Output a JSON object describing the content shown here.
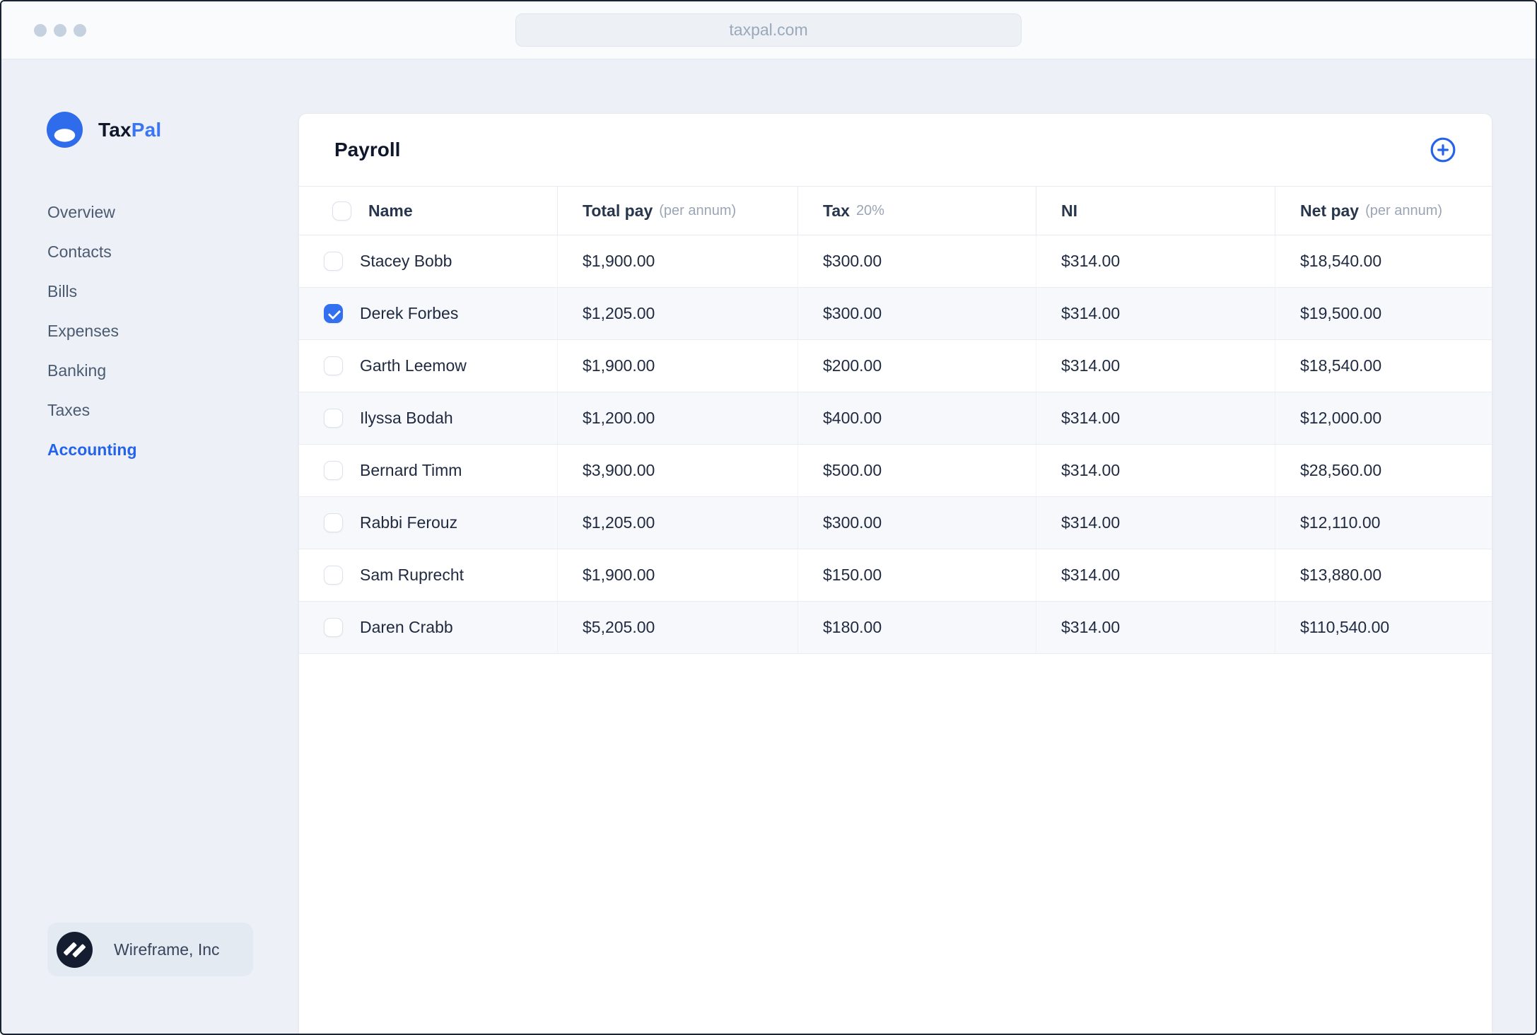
{
  "browser": {
    "url": "taxpal.com"
  },
  "brand": {
    "name_primary": "Tax",
    "name_secondary": "Pal"
  },
  "sidebar": {
    "items": [
      "Overview",
      "Contacts",
      "Bills",
      "Expenses",
      "Banking",
      "Taxes",
      "Accounting"
    ],
    "active_item": "Accounting",
    "org": {
      "name": "Wireframe, Inc"
    }
  },
  "main": {
    "title": "Payroll"
  },
  "table": {
    "select_all_checked": false,
    "columns": [
      {
        "label": "Name",
        "sub": ""
      },
      {
        "label": "Total pay",
        "sub": "(per annum)"
      },
      {
        "label": "Tax",
        "sub": "20%"
      },
      {
        "label": "NI",
        "sub": ""
      },
      {
        "label": "Net pay",
        "sub": "(per annum)"
      }
    ],
    "rows": [
      {
        "name": "Stacey Bobb",
        "total_pay": "$1,900.00",
        "tax": "$300.00",
        "ni": "$314.00",
        "net_pay": "$18,540.00",
        "checked": false
      },
      {
        "name": "Derek Forbes",
        "total_pay": "$1,205.00",
        "tax": "$300.00",
        "ni": "$314.00",
        "net_pay": "$19,500.00",
        "checked": true
      },
      {
        "name": "Garth Leemow",
        "total_pay": "$1,900.00",
        "tax": "$200.00",
        "ni": "$314.00",
        "net_pay": "$18,540.00",
        "checked": false
      },
      {
        "name": "Ilyssa Bodah",
        "total_pay": "$1,200.00",
        "tax": "$400.00",
        "ni": "$314.00",
        "net_pay": "$12,000.00",
        "checked": false
      },
      {
        "name": "Bernard Timm",
        "total_pay": "$3,900.00",
        "tax": "$500.00",
        "ni": "$314.00",
        "net_pay": "$28,560.00",
        "checked": false
      },
      {
        "name": "Rabbi Ferouz",
        "total_pay": "$1,205.00",
        "tax": "$300.00",
        "ni": "$314.00",
        "net_pay": "$12,110.00",
        "checked": false
      },
      {
        "name": "Sam Ruprecht",
        "total_pay": "$1,900.00",
        "tax": "$150.00",
        "ni": "$314.00",
        "net_pay": "$13,880.00",
        "checked": false
      },
      {
        "name": "Daren Crabb",
        "total_pay": "$5,205.00",
        "tax": "$180.00",
        "ni": "$314.00",
        "net_pay": "$110,540.00",
        "checked": false
      }
    ]
  },
  "colors": {
    "accent_blue": "#2563eb",
    "checkbox_checked": "#3370f0",
    "brand_dark": "#0f172a",
    "sidebar_text": "#4a5a70",
    "page_bg": "#edf1f7"
  }
}
